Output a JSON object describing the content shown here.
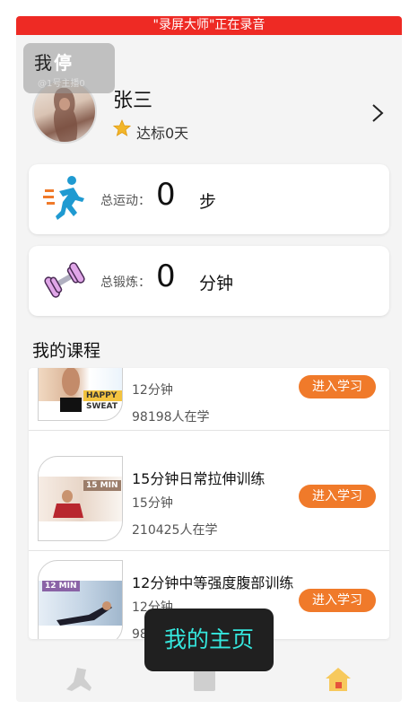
{
  "status_bar": {
    "recording_text": "\"录屏大师\"正在录音"
  },
  "floating_overlay": {
    "label_a": "我",
    "label_b": "停",
    "small_text": "@1号主播0"
  },
  "profile": {
    "name": "张三",
    "streak": "达标0天"
  },
  "stats": [
    {
      "label": "总运动：",
      "value": "0",
      "unit": "步",
      "icon": "running-person-icon"
    },
    {
      "label": "总锻炼：",
      "value": "0",
      "unit": "分钟",
      "icon": "dumbbell-icon"
    }
  ],
  "courses_section": {
    "title": "我的课程"
  },
  "courses": [
    {
      "title": "",
      "duration": "12分钟",
      "learners": "98198人在学",
      "thumb_tag": "HAPPY SWEAT",
      "button": "进入学习"
    },
    {
      "title": "15分钟日常拉伸训练",
      "duration": "15分钟",
      "learners": "210425人在学",
      "thumb_tag": "15 MIN",
      "button": "进入学习"
    },
    {
      "title": "12分钟中等强度腹部训练",
      "duration": "12分钟",
      "learners": "98154人在学",
      "thumb_tag": "12 MIN",
      "button": "进入学习"
    }
  ],
  "toast": {
    "text": "我的主页"
  },
  "colors": {
    "accent": "#f07a2a",
    "recording": "#ee2a24",
    "toast_text": "#35e6dd"
  }
}
